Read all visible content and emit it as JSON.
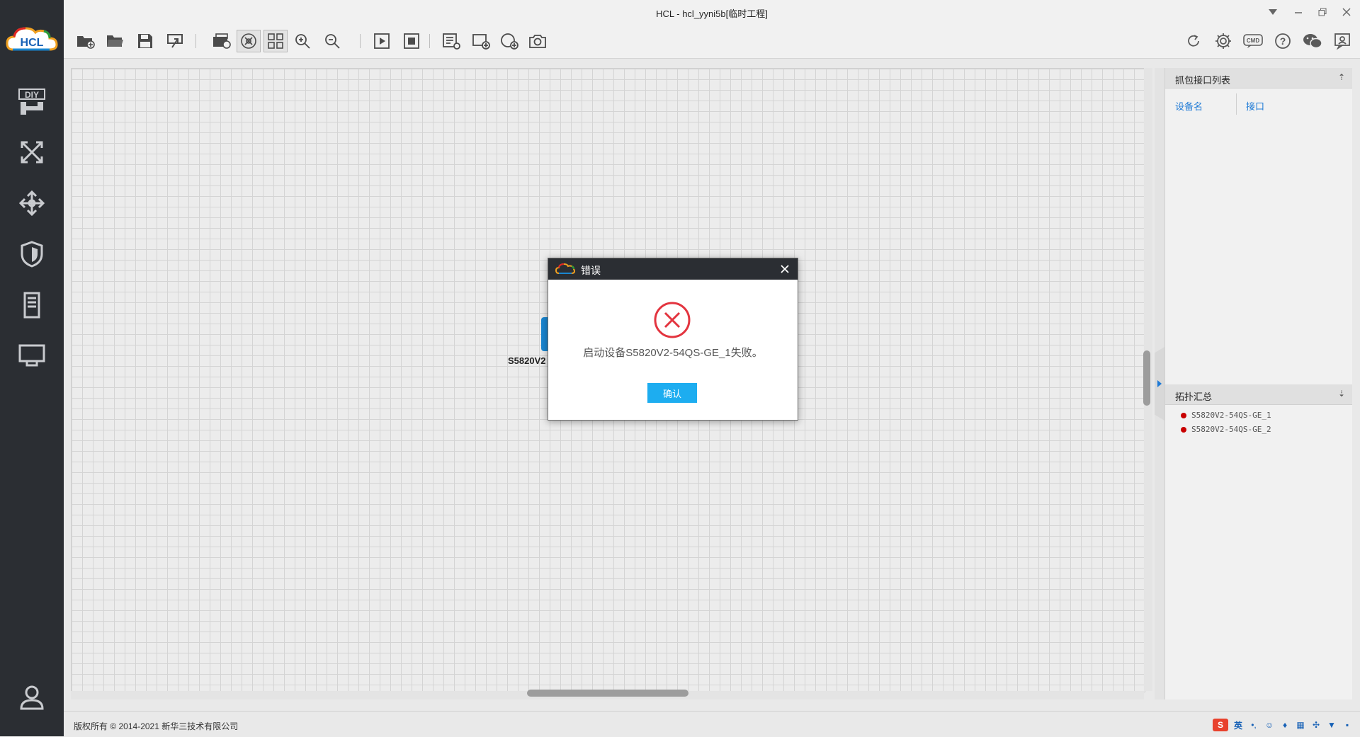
{
  "window": {
    "title": "HCL - hcl_yyni5b[临时工程]"
  },
  "sidebar": {
    "logo_text": "HCL",
    "items": [
      {
        "icon": "diy-icon"
      },
      {
        "icon": "router-icon"
      },
      {
        "icon": "switch-icon"
      },
      {
        "icon": "firewall-icon"
      },
      {
        "icon": "server-icon"
      },
      {
        "icon": "terminal-icon"
      }
    ],
    "user_icon": "user-icon"
  },
  "canvas": {
    "device_label": "S5820V2"
  },
  "right_panel": {
    "capture_title": "抓包接口列表",
    "col_device": "设备名",
    "col_interface": "接口",
    "topology_title": "拓扑汇总",
    "devices": [
      "S5820V2-54QS-GE_1",
      "S5820V2-54QS-GE_2"
    ],
    "status_color": "#c80000"
  },
  "status": {
    "copyright": "版权所有 © 2014-2021 新华三技术有限公司",
    "ime_label": "英"
  },
  "dialog": {
    "title": "错误",
    "message": "启动设备S5820V2-54QS-GE_1失败。",
    "ok_label": "确认",
    "accent": "#1dadf0",
    "error_color": "#e3343f"
  }
}
